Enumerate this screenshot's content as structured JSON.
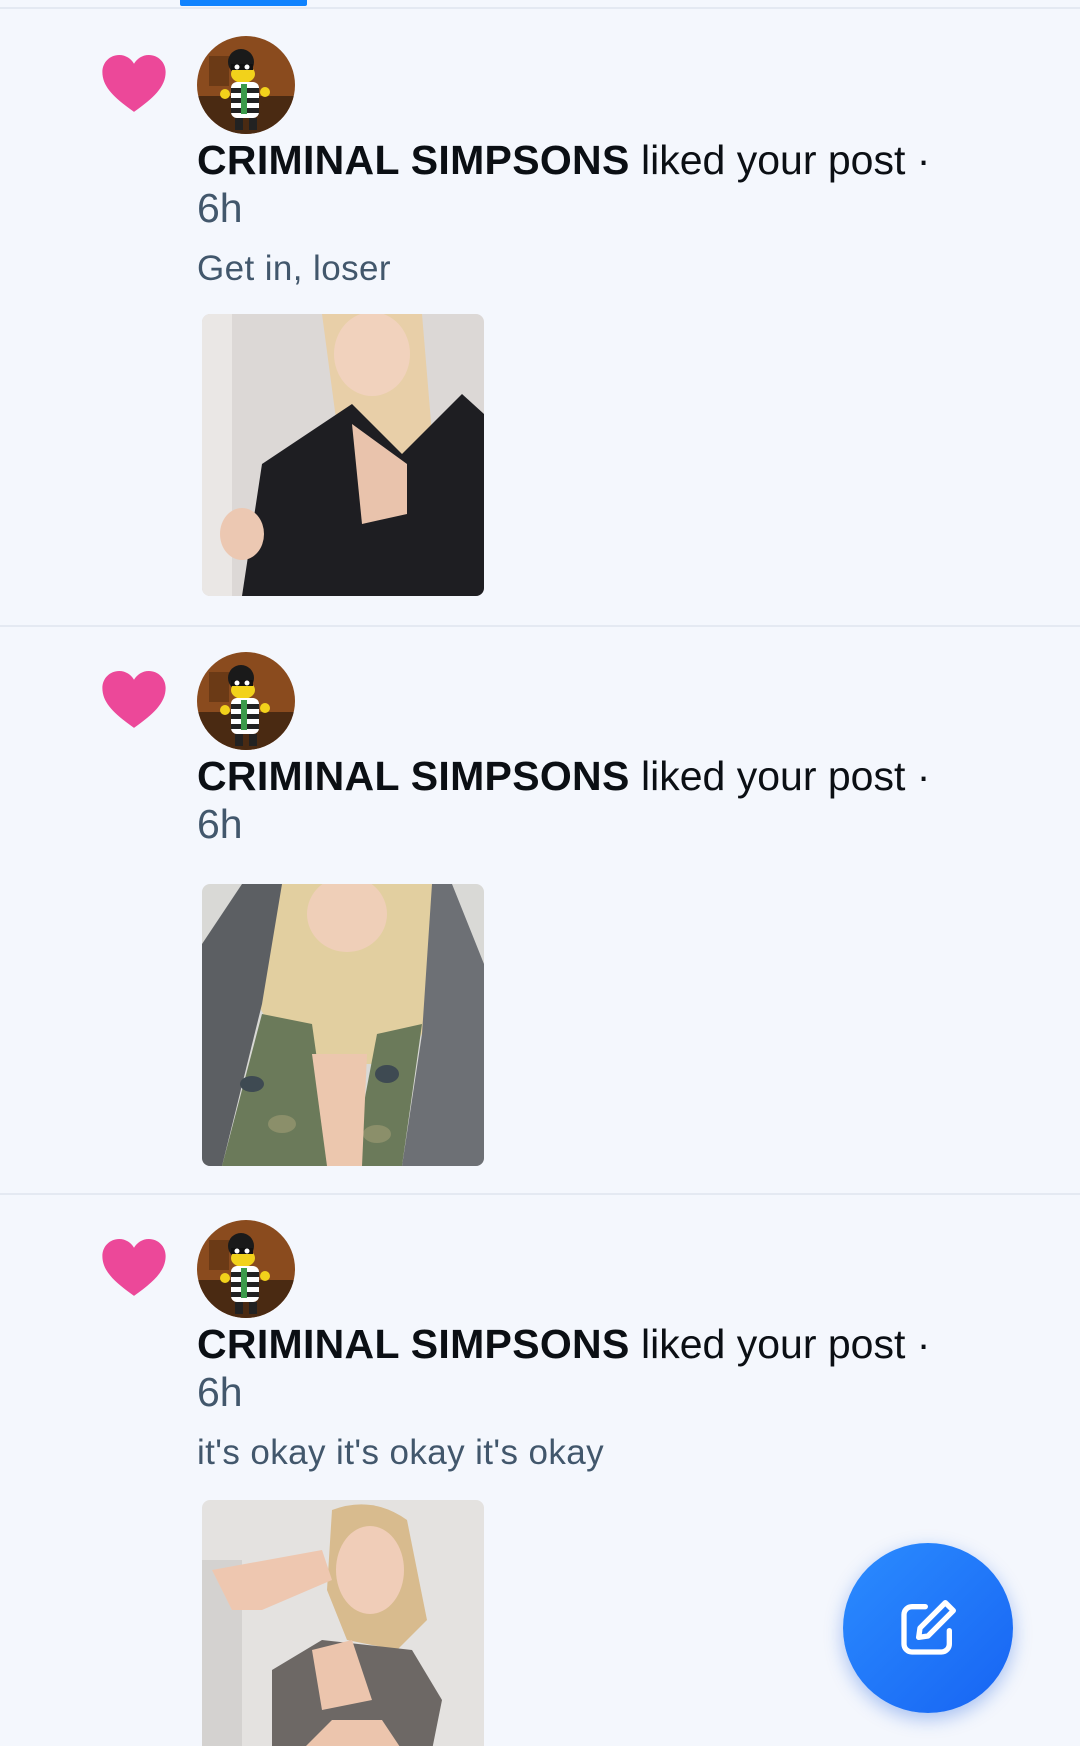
{
  "colors": {
    "accent": "#1083fe",
    "like": "#ec4899",
    "background": "#f4f7fd"
  },
  "notifications": [
    {
      "avatar_icon": "burglar-cartoon-avatar",
      "name": "CRIMINAL SIMPSONS",
      "action": "liked your post",
      "separator": "·",
      "time": "6h",
      "snippet": "Get in, loser",
      "thumbnail": "post-photo-black-top"
    },
    {
      "avatar_icon": "burglar-cartoon-avatar",
      "name": "CRIMINAL SIMPSONS",
      "action": "liked your post",
      "separator": "·",
      "time": "6h",
      "snippet": "",
      "thumbnail": "post-photo-camo-hoodie"
    },
    {
      "avatar_icon": "burglar-cartoon-avatar",
      "name": "CRIMINAL SIMPSONS",
      "action": "liked your post",
      "separator": "·",
      "time": "6h",
      "snippet": "it's okay it's okay it's okay",
      "thumbnail": "post-photo-grey-tank"
    }
  ],
  "compose_button": {
    "icon": "compose-icon"
  }
}
